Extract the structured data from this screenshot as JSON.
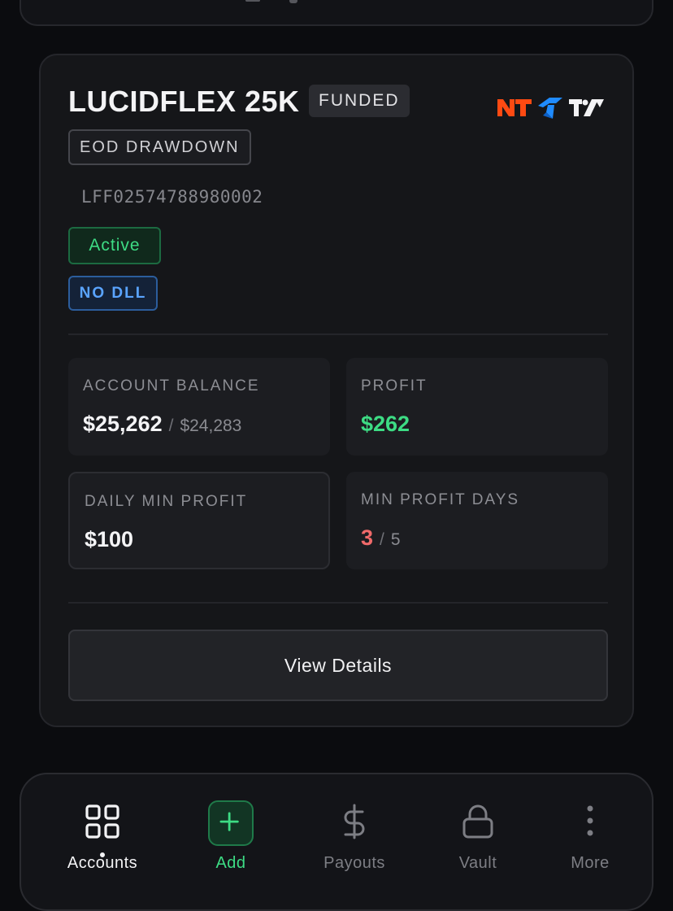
{
  "account": {
    "title": "LUCIDFLEX 25K",
    "status_tag": "FUNDED",
    "drawdown_type": "EOD DRAWDOWN",
    "account_id": "LFF02574788980002",
    "state_badge": "Active",
    "dll_badge": "NO DLL",
    "platform_logos": [
      "ninjatrader-logo",
      "tradovate-logo",
      "tradingview-logo"
    ]
  },
  "stats": {
    "balance": {
      "label": "ACCOUNT BALANCE",
      "value": "$25,262",
      "separator": "/",
      "secondary": "$24,283"
    },
    "profit": {
      "label": "PROFIT",
      "value": "$262",
      "color": "#3ddc84"
    },
    "daily_min": {
      "label": "DAILY MIN PROFIT",
      "value": "$100"
    },
    "min_days": {
      "label": "MIN PROFIT DAYS",
      "value": "3",
      "separator": "/",
      "secondary": "5",
      "color": "#f06a6a"
    }
  },
  "actions": {
    "view_details": "View Details"
  },
  "tabbar": {
    "items": [
      {
        "label": "Accounts",
        "icon": "grid-icon",
        "active": true
      },
      {
        "label": "Add",
        "icon": "plus-icon",
        "accent": "#3ddc84"
      },
      {
        "label": "Payouts",
        "icon": "dollar-icon"
      },
      {
        "label": "Vault",
        "icon": "lock-icon"
      },
      {
        "label": "More",
        "icon": "more-vertical-icon"
      }
    ]
  },
  "colors": {
    "background": "#0b0c0f",
    "card": "#151619",
    "accent_green": "#3ddc84",
    "accent_blue": "#5aa4ff",
    "ninjatrader": "#ff4a12",
    "tradovate": "#1f8bff"
  }
}
